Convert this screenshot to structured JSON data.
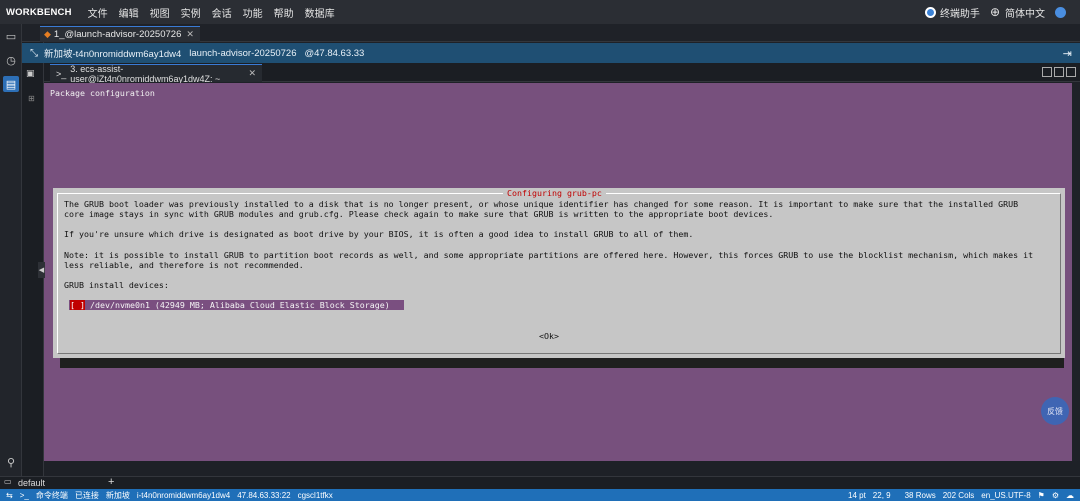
{
  "menubar": {
    "logo": "WORKBENCH",
    "items": [
      "文件",
      "编辑",
      "视图",
      "实例",
      "会话",
      "功能",
      "帮助",
      "数据库"
    ],
    "assistant": "终端助手",
    "language": "简体中文"
  },
  "session_tab": {
    "label": "1_@launch-advisor-20250726"
  },
  "info_row": {
    "segments": [
      "新加坡-t4n0nromiddwm6ay1dw4",
      "launch-advisor-20250726",
      "@47.84.63.33"
    ]
  },
  "terminal_tab": {
    "label": "3. ecs-assist-user@iZt4n0nromiddwm6ay1dw4Z: ~"
  },
  "terminal": {
    "header": "Package configuration",
    "dialog": {
      "title": "Configuring grub-pc",
      "lines": [
        "The GRUB boot loader was previously installed to a disk that is no longer present, or whose unique identifier has changed for some reason. It is important to make sure that the installed GRUB",
        "core image stays in sync with GRUB modules and grub.cfg. Please check again to make sure that GRUB is written to the appropriate boot devices.",
        "",
        "If you're unsure which drive is designated as boot drive by your BIOS, it is often a good idea to install GRUB to all of them.",
        "",
        "Note: it is possible to install GRUB to partition boot records as well, and some appropriate partitions are offered here. However, this forces GRUB to use the blocklist mechanism, which makes it",
        "less reliable, and therefore is not recommended.",
        "",
        "GRUB install devices:"
      ],
      "device_checkbox": "[ ]",
      "device": " /dev/nvme0n1 (42949 MB; Alibaba Cloud Elastic Block Storage)",
      "ok": "<Ok>"
    }
  },
  "workspace": {
    "name": "default",
    "add": "+"
  },
  "floating_button": "反馈",
  "statusbar": {
    "items": [
      "命令终端",
      "已连接",
      "新加坡",
      "i-t4n0nromiddwm6ay1dw4",
      "47.84.63.33:22",
      "cgscl1tfkx"
    ],
    "right_items": [
      "14 pt",
      "22, 9",
      "38 Rows",
      "202 Cols",
      "en_US.UTF-8"
    ]
  },
  "colors": {
    "terminal_bg": "#77507d",
    "dialog_bg": "#c6c6c6",
    "dialog_title": "#c00000",
    "statusbar_bg": "#1f6fb8",
    "info_row_bg": "#1f4f73"
  }
}
